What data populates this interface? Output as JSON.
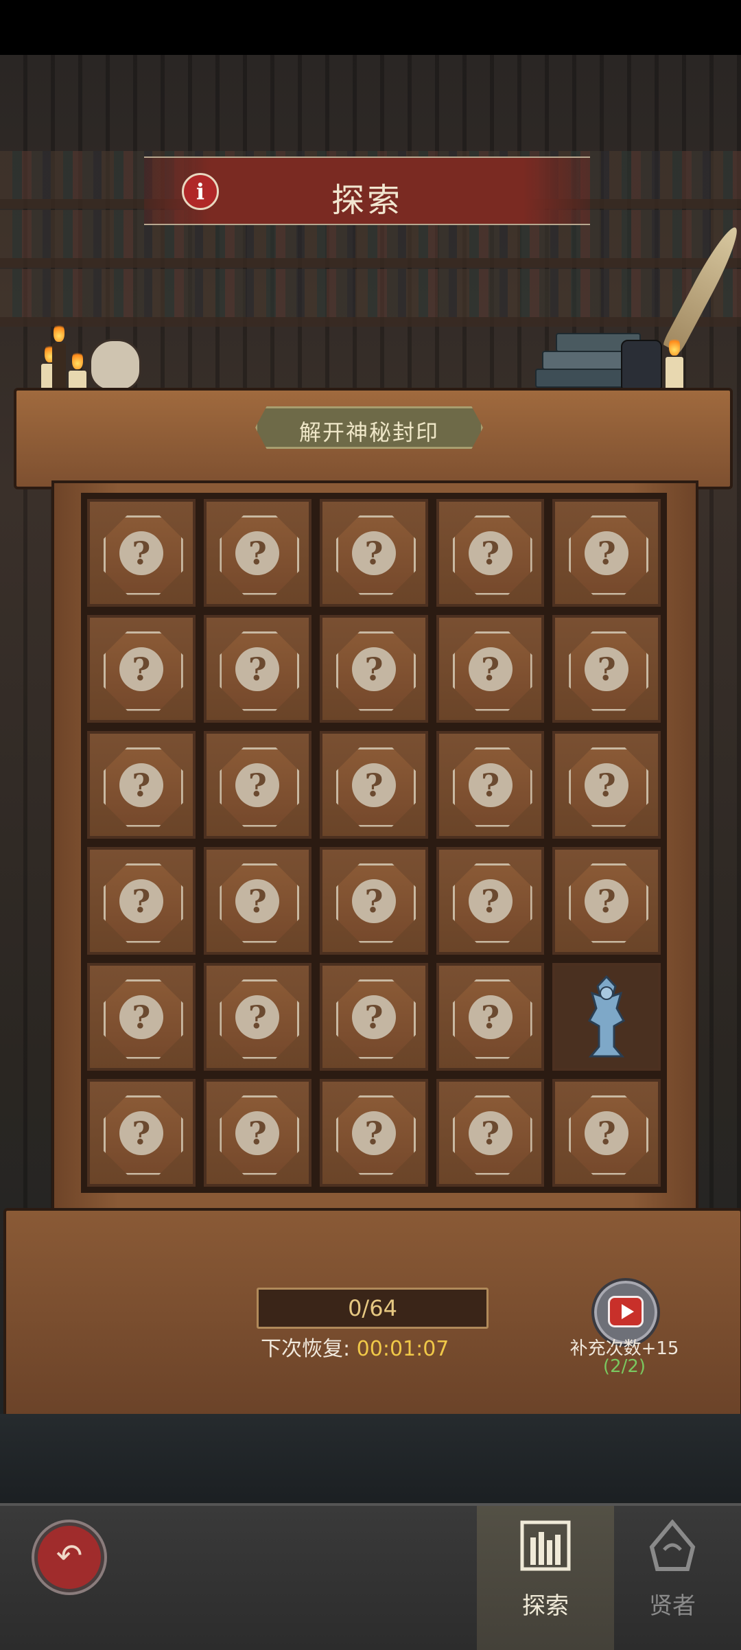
{
  "header": {
    "title": "探索",
    "info_icon": "i"
  },
  "board": {
    "seal_label": "解开神秘封印",
    "rows": 6,
    "cols": 5,
    "hidden_glyph": "?",
    "revealed_cell": {
      "row": 5,
      "col": 5,
      "content": "statue-icon"
    }
  },
  "progress": {
    "count": "0/64",
    "recover_label": "下次恢复:",
    "recover_time": "00:01:07"
  },
  "refill": {
    "label": "补充次数+15",
    "count": "(2/2)"
  },
  "nav": {
    "back_glyph": "↶",
    "tabs": [
      {
        "label": "探索",
        "icon": "bookshelf-icon",
        "active": true
      },
      {
        "label": "贤者",
        "icon": "sage-icon",
        "active": false
      }
    ]
  },
  "colors": {
    "banner": "#7a2a22",
    "timer": "#f0c848",
    "refill_count": "#7ac860",
    "progress_text": "#e6c882"
  }
}
